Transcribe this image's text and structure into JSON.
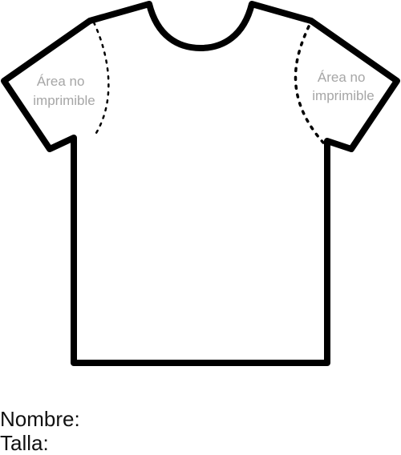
{
  "shirt": {
    "outline_color": "#000000",
    "fill_color": "#ffffff",
    "left_zone_label": [
      "Área no",
      "imprimible"
    ],
    "right_zone_label": [
      "Área no",
      "imprimible"
    ],
    "zone_label_color": "#a6a6a6"
  },
  "form": {
    "name_label": "Nombre:",
    "size_label": "Talla:"
  }
}
